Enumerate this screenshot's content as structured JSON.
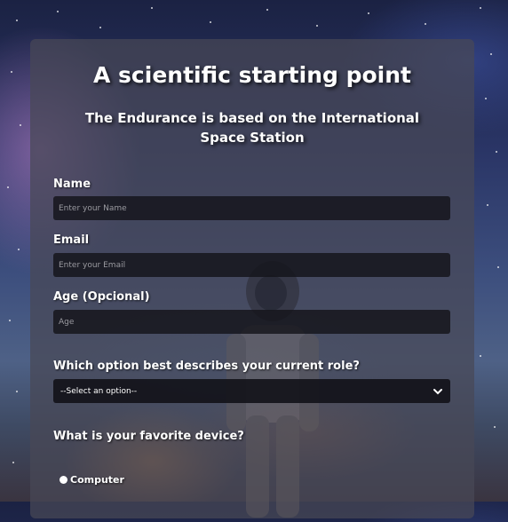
{
  "form": {
    "title": "A scientific starting point",
    "subtitle": "The Endurance is based on the International Space Station",
    "name": {
      "label": "Name",
      "placeholder": "Enter your Name",
      "value": ""
    },
    "email": {
      "label": "Email",
      "placeholder": "Enter your Email",
      "value": ""
    },
    "age": {
      "label": "Age (Opcional)",
      "placeholder": "Age",
      "value": ""
    },
    "role": {
      "label": "Which option best describes your current role?",
      "selected": "--Select an option--"
    },
    "device": {
      "label": "What is your favorite device?",
      "options": [
        {
          "label": "Computer"
        }
      ]
    }
  }
}
